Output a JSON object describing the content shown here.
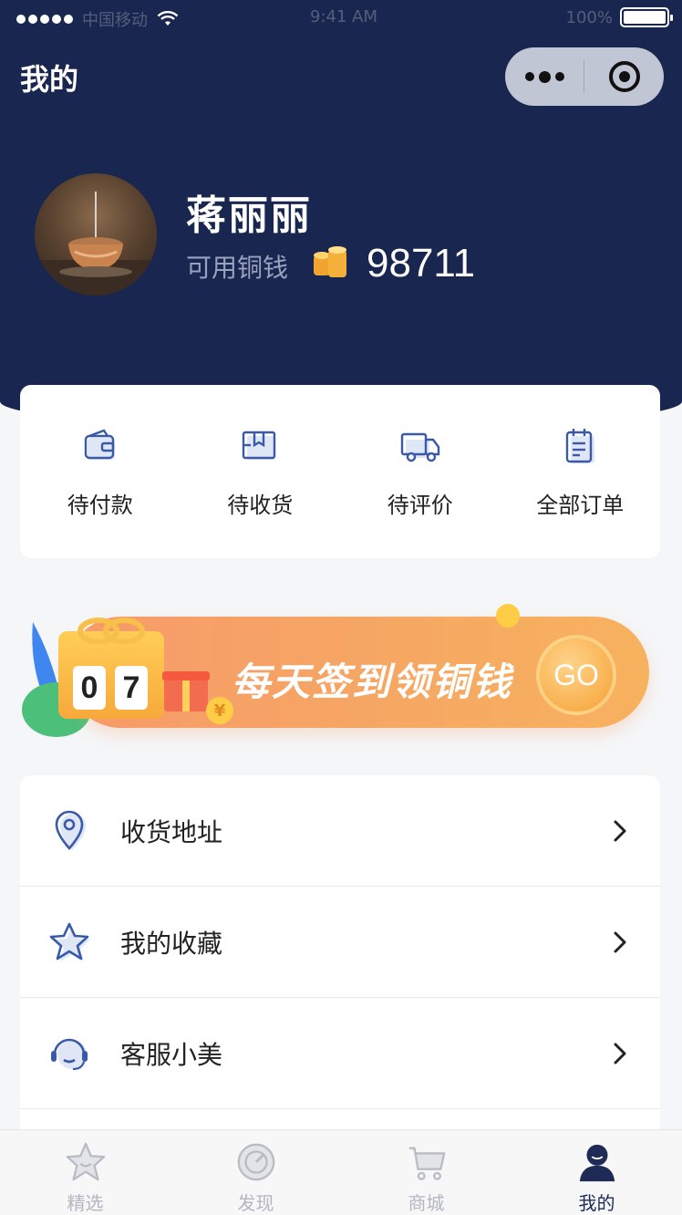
{
  "status_bar": {
    "carrier": "中国移动",
    "time": "9:41 AM",
    "battery_pct": "100%",
    "battery_level": 1.0
  },
  "header": {
    "title": "我的"
  },
  "profile": {
    "name": "蒋丽丽",
    "coins_label": "可用铜钱",
    "coins_value": "98711"
  },
  "orders": [
    {
      "label": "待付款",
      "icon": "wallet-icon"
    },
    {
      "label": "待收货",
      "icon": "package-icon"
    },
    {
      "label": "待评价",
      "icon": "truck-icon"
    },
    {
      "label": "全部订单",
      "icon": "document-icon"
    }
  ],
  "banner": {
    "text": "每天签到领铜钱",
    "go_label": "GO",
    "calendar_digits": [
      "0",
      "7"
    ],
    "currency_symbol": "¥"
  },
  "menu": [
    {
      "label": "收货地址",
      "icon": "location-pin-icon"
    },
    {
      "label": "我的收藏",
      "icon": "star-icon"
    },
    {
      "label": "客服小美",
      "icon": "headset-icon"
    }
  ],
  "tabbar": [
    {
      "label": "精选",
      "icon": "star-face-icon",
      "active": false
    },
    {
      "label": "发现",
      "icon": "compass-icon",
      "active": false
    },
    {
      "label": "商城",
      "icon": "cart-icon",
      "active": false
    },
    {
      "label": "我的",
      "icon": "user-icon",
      "active": true
    }
  ],
  "colors": {
    "header_bg": "#19264f",
    "accent": "#1e2b57",
    "icon_blue": "#3a5aa8",
    "banner_orange": "#f6a763"
  }
}
